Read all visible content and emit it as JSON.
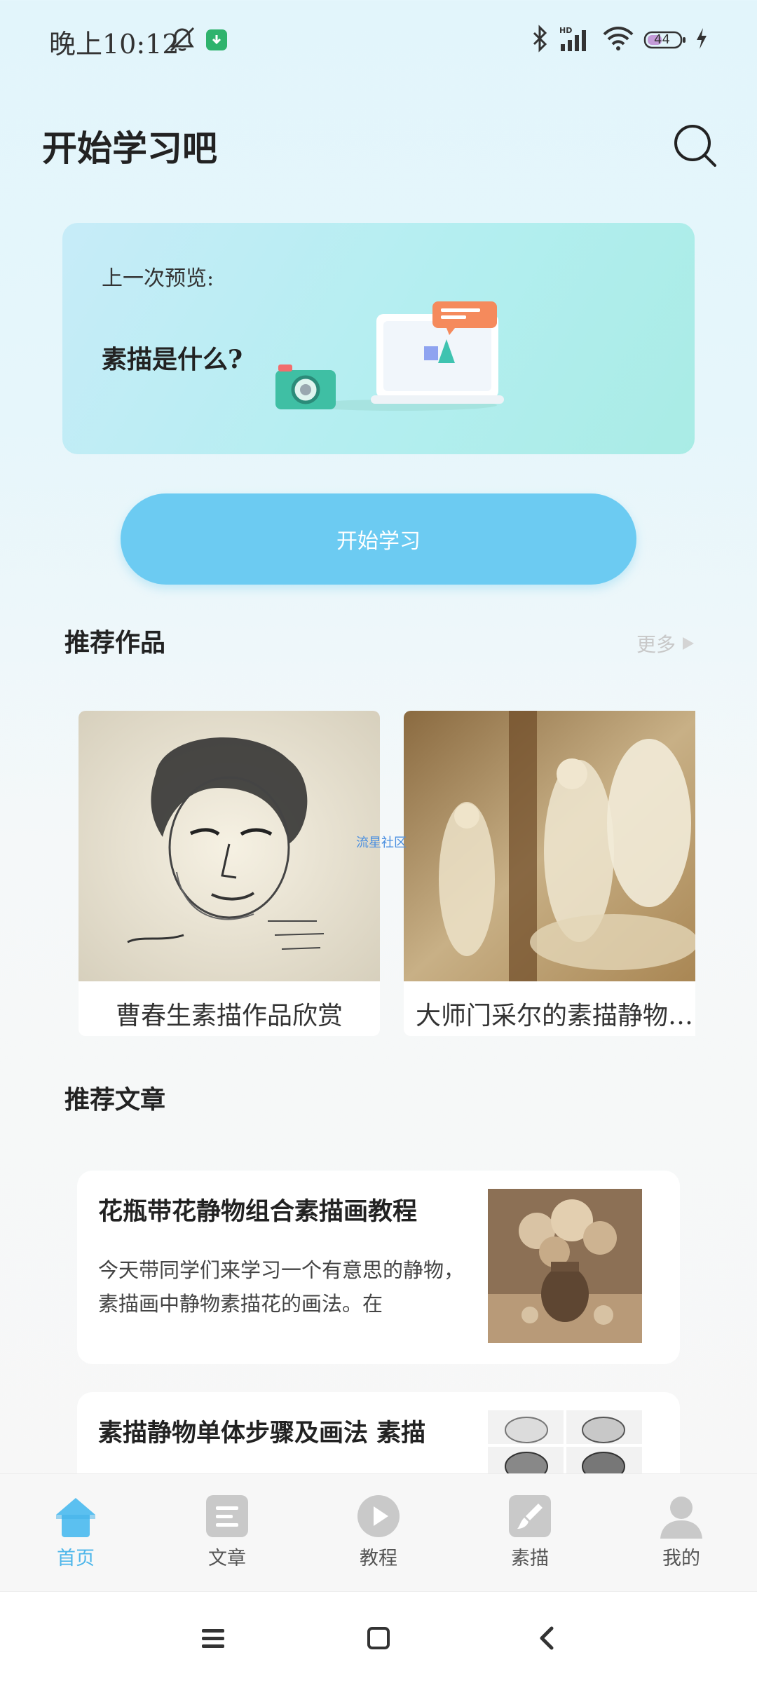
{
  "status_bar": {
    "time": "晚上10:12",
    "battery": "44",
    "icons": [
      "mute-icon",
      "download-icon",
      "bluetooth-icon",
      "signal-icon",
      "wifi-icon",
      "battery-icon",
      "charging-icon"
    ]
  },
  "header": {
    "title": "开始学习吧",
    "search_icon": "search-icon"
  },
  "last_preview": {
    "label": "上一次预览:",
    "topic": "素描是什么?"
  },
  "start_button": {
    "label": "开始学习"
  },
  "recommended_works": {
    "heading": "推荐作品",
    "more_label": "更多",
    "items": [
      {
        "title": "曹春生素描作品欣赏"
      },
      {
        "title": "大师门采尔的素描静物…"
      }
    ],
    "watermark": "流星社区"
  },
  "recommended_articles": {
    "heading": "推荐文章",
    "items": [
      {
        "title": "花瓶带花静物组合素描画教程",
        "excerpt": " 今天带同学们来学习一个有意思的静物，素描画中静物素描花的画法。在"
      },
      {
        "title": "素描静物单体步骤及画法 素描",
        "excerpt": ""
      }
    ]
  },
  "bottom_nav": {
    "items": [
      {
        "label": "首页",
        "icon": "home-icon",
        "active": true
      },
      {
        "label": "文章",
        "icon": "article-icon",
        "active": false
      },
      {
        "label": "教程",
        "icon": "play-icon",
        "active": false
      },
      {
        "label": "素描",
        "icon": "brush-icon",
        "active": false
      },
      {
        "label": "我的",
        "icon": "user-icon",
        "active": false
      }
    ]
  },
  "colors": {
    "accent": "#6ccbf2",
    "active_tab": "#4db6ea",
    "inactive_icon": "#c9c9c9"
  }
}
